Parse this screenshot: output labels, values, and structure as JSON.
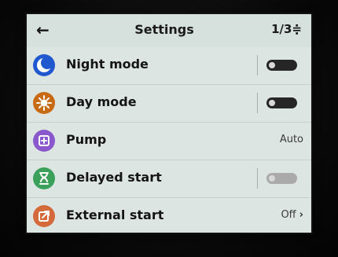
{
  "header": {
    "title": "Settings",
    "page_indicator": "1/3≑"
  },
  "rows": [
    {
      "label": "Night mode",
      "icon": "moon-icon",
      "icon_color": "#1f58cf",
      "control": "toggle"
    },
    {
      "label": "Day mode",
      "icon": "sun-icon",
      "icon_color": "#c86a14",
      "control": "toggle"
    },
    {
      "label": "Pump",
      "icon": "pump-icon",
      "icon_color": "#8a57cc",
      "value": "Auto"
    },
    {
      "label": "Delayed start",
      "icon": "hourglass-icon",
      "icon_color": "#3aa05a",
      "control": "toggle"
    },
    {
      "label": "External start",
      "icon": "external-start-icon",
      "icon_color": "#d46a3b",
      "value": "Off"
    }
  ]
}
